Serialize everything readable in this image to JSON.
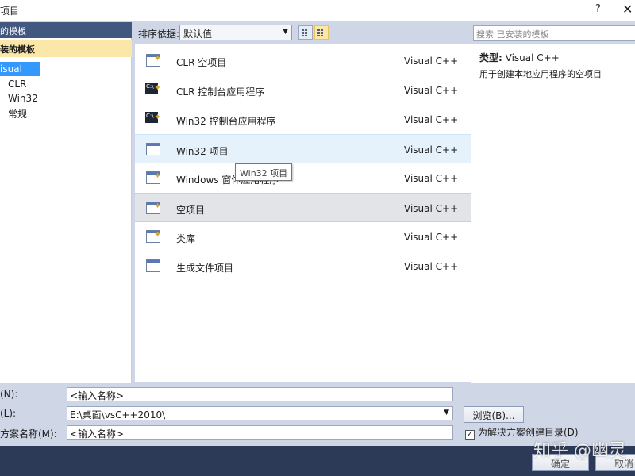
{
  "window": {
    "title": "项目",
    "help": "?",
    "close": "✕"
  },
  "left": {
    "header": "的模板",
    "installed": "装的模板",
    "tree": [
      "isual C++",
      "CLR",
      "Win32",
      "常规"
    ]
  },
  "center": {
    "sort_label": "排序依据:",
    "sort_value": "默认值",
    "templates": [
      {
        "name": "CLR 空项目",
        "lang": "Visual C++",
        "icon": "clr-empty-icon"
      },
      {
        "name": "CLR 控制台应用程序",
        "lang": "Visual C++",
        "icon": "clr-console-icon"
      },
      {
        "name": "Win32 控制台应用程序",
        "lang": "Visual C++",
        "icon": "win32-console-icon"
      },
      {
        "name": "Win32 项目",
        "lang": "Visual C++",
        "icon": "win32-project-icon"
      },
      {
        "name": "Windows 窗体应用程序",
        "lang": "Visual C++",
        "icon": "windows-forms-icon"
      },
      {
        "name": "空项目",
        "lang": "Visual C++",
        "icon": "empty-project-icon"
      },
      {
        "name": "类库",
        "lang": "Visual C++",
        "icon": "class-library-icon"
      },
      {
        "name": "生成文件项目",
        "lang": "Visual C++",
        "icon": "makefile-project-icon"
      }
    ],
    "tooltip": "Win32 项目"
  },
  "right": {
    "search_placeholder": "搜索 已安装的模板",
    "type_label": "类型:",
    "type_value": "Visual C++",
    "description": "用于创建本地应用程序的空项目"
  },
  "form": {
    "name_label": "(N):",
    "name_value": "<输入名称>",
    "location_label": "(L):",
    "location_value": "E:\\桌面\\vsC++2010\\",
    "solution_label": "方案名称(M):",
    "solution_value": "<输入名称>",
    "browse": "浏览(B)...",
    "create_dir_checked": "✓",
    "create_dir_label": "为解决方案创建目录(D)"
  },
  "bottom": {
    "ok": "确定",
    "cancel": "取消"
  },
  "watermark": "知乎 @幽灵"
}
